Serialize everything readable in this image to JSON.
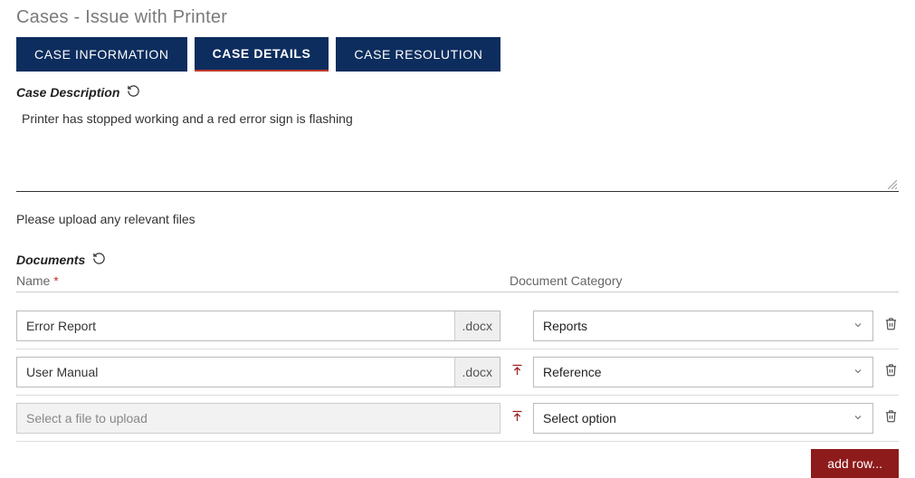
{
  "page": {
    "title": "Cases - Issue with Printer"
  },
  "tabs": [
    {
      "label": "CASE INFORMATION"
    },
    {
      "label": "CASE DETAILS"
    },
    {
      "label": "CASE RESOLUTION"
    }
  ],
  "description": {
    "header": "Case Description",
    "value": "Printer has stopped working and a red error sign is flashing"
  },
  "upload_helper": "Please upload any relevant files",
  "documents": {
    "header": "Documents",
    "columns": {
      "name": "Name",
      "category": "Document Category"
    },
    "placeholder": "Select a file to upload",
    "select_placeholder": "Select option",
    "rows": [
      {
        "name": "Error Report",
        "ext": ".docx",
        "category": "Reports",
        "show_upload": false
      },
      {
        "name": "User Manual",
        "ext": ".docx",
        "category": "Reference",
        "show_upload": true
      }
    ],
    "add_row_label": "add row..."
  }
}
